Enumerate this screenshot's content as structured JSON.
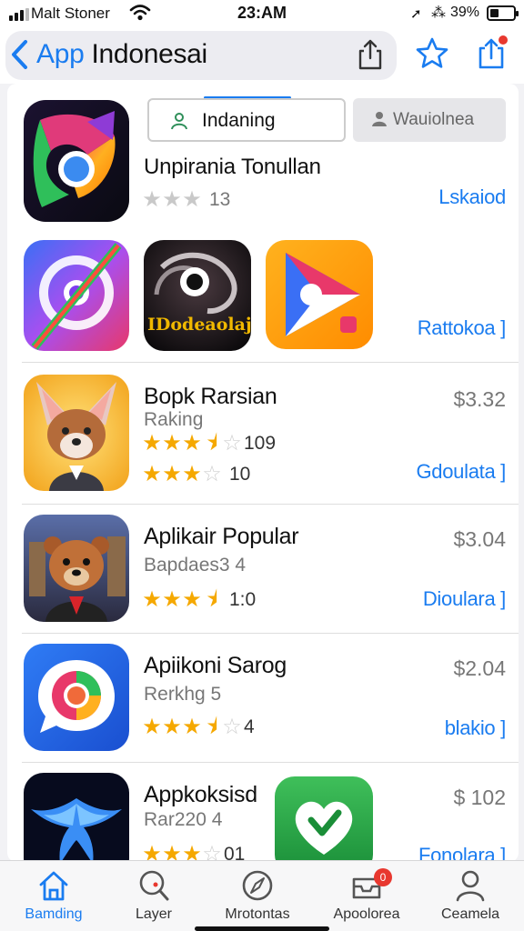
{
  "status_bar": {
    "carrier": "Malt Stoner",
    "time": "23:AM",
    "battery_text": "39%",
    "battery_level": 0.39,
    "icons": [
      "signal-bars",
      "wifi-icon",
      "location-icon",
      "bluetooth-icon",
      "battery-icon"
    ]
  },
  "nav": {
    "title_blue": "App ",
    "title_dark": "Indonesai",
    "icons": [
      "chevron-left-icon",
      "share-icon",
      "star-icon",
      "upload-icon"
    ],
    "accent": "#1a7cf0",
    "badge_color": "#e8382f"
  },
  "segments": [
    {
      "label": "Indaning",
      "icon": "person-icon",
      "selected": true
    },
    {
      "label": "Wauiolnea",
      "icon": "person-icon",
      "selected": false
    }
  ],
  "featured": {
    "title": "Unpirania Tonullan",
    "rating": 3,
    "rating_count": "13",
    "action": "Lskaiod"
  },
  "icon_row": {
    "badge_text": "IDodeaolaj",
    "action": "Rattokoa ]"
  },
  "apps": [
    {
      "name": "Bopk Rarsian",
      "sub": "Raking",
      "rating": 3.5,
      "rating_count": "109",
      "rating2": 3,
      "rating_count2": "10",
      "price": "$3.32",
      "action": "Gdoulata ]"
    },
    {
      "name": "Aplikair Popular",
      "sub": "Bapdaes3 4",
      "rating": 3.5,
      "rating_count": "1:0",
      "price": "$3.04",
      "action": "Dioulara ]"
    },
    {
      "name": "Apiikoni Sarog",
      "sub": "Rerkhg 5",
      "rating": 3.5,
      "rating_count": "4",
      "price": "$2.04",
      "action": "blakio ]"
    },
    {
      "name": "Appkoksisd",
      "sub": "Rar220 4",
      "rating": 3,
      "rating_count": "01",
      "price": "$ 102",
      "action": "Fonolara ]"
    }
  ],
  "tabs": [
    {
      "label": "Bamding",
      "icon": "home-icon",
      "active": true
    },
    {
      "label": "Layer",
      "icon": "search-icon",
      "active": false
    },
    {
      "label": "Mrotontas",
      "icon": "compass-icon",
      "active": false
    },
    {
      "label": "Apoolorea",
      "icon": "inbox-icon",
      "active": false,
      "badge": "0"
    },
    {
      "label": "Ceamela",
      "icon": "person-icon",
      "active": false
    }
  ]
}
